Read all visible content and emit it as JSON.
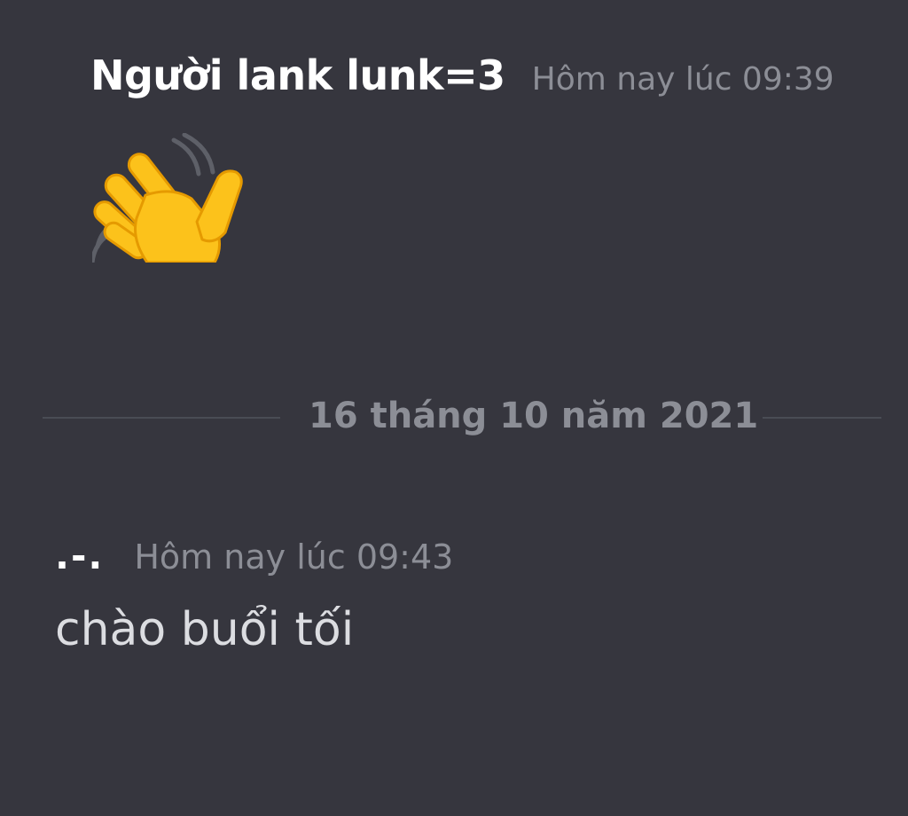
{
  "messages": [
    {
      "author": "Người lank lunk=3",
      "timestamp": "Hôm nay lúc 09:39",
      "content_icon": "waving-hand-emoji"
    },
    {
      "author": ".-.",
      "timestamp": "Hôm nay lúc 09:43",
      "text": "chào buổi tối"
    }
  ],
  "date_divider": "16 tháng 10 năm 2021",
  "colors": {
    "background": "#36363e",
    "author": "#ffffff",
    "timestamp": "#8c8e96",
    "message_text": "#dcdde1",
    "divider": "#4a4c54",
    "emoji_fill": "#fcc21b",
    "emoji_outline": "#e59a00"
  }
}
